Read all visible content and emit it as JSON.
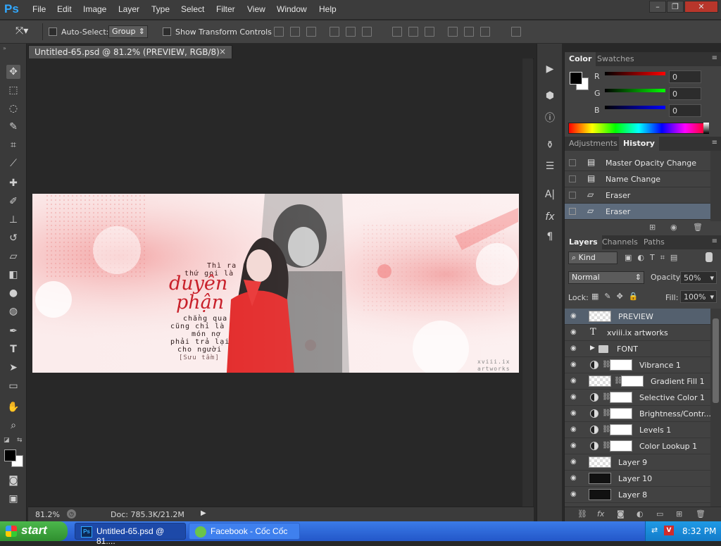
{
  "app": {
    "logo": "Ps",
    "menu": [
      "File",
      "Edit",
      "Image",
      "Layer",
      "Type",
      "Select",
      "Filter",
      "View",
      "Window",
      "Help"
    ],
    "window_controls": [
      "–",
      "❐",
      "✕"
    ]
  },
  "options_bar": {
    "auto_select_label": "Auto-Select:",
    "auto_select_value": "Group",
    "show_transform_label": "Show Transform Controls"
  },
  "document": {
    "tab_title": "Untitled-65.psd @ 81.2% (PREVIEW, RGB/8) *",
    "close": "×",
    "artwork_text": {
      "line1": "Thì ra",
      "line2": "thứ gọi là",
      "title1": "duyên",
      "title2": "phận",
      "line3": "chẳng qua",
      "line4": "cũng chỉ là",
      "line5": "món nợ",
      "line6": "phải trả lại",
      "line7": "cho người",
      "credit": "[Sưu tầm]",
      "watermark1": "xviii.ix",
      "watermark2": "artworks"
    }
  },
  "status_bar": {
    "zoom": "81.2%",
    "doc_info": "Doc: 785.3K/21.2M"
  },
  "color_panel": {
    "tabs": [
      "Color",
      "Swatches"
    ],
    "active_tab": "Color",
    "channels": [
      {
        "label": "R",
        "value": "0",
        "color": "#e01010"
      },
      {
        "label": "G",
        "value": "0",
        "color": "#10c010"
      },
      {
        "label": "B",
        "value": "0",
        "color": "#1010e0"
      }
    ]
  },
  "history_panel": {
    "tabs": [
      "Adjustments",
      "History"
    ],
    "active_tab": "History",
    "items": [
      "Master Opacity Change",
      "Name Change",
      "Eraser",
      "Eraser"
    ]
  },
  "layers_panel": {
    "tabs": [
      "Layers",
      "Channels",
      "Paths"
    ],
    "active_tab": "Layers",
    "kind_label": "Kind",
    "blend_mode": "Normal",
    "opacity_label": "Opacity:",
    "opacity_value": "50%",
    "lock_label": "Lock:",
    "fill_label": "Fill:",
    "fill_value": "100%",
    "layers": [
      {
        "name": "PREVIEW",
        "type": "pixel",
        "selected": true
      },
      {
        "name": "xviii.ix artworks",
        "type": "text"
      },
      {
        "name": "FONT",
        "type": "group"
      },
      {
        "name": "Vibrance 1",
        "type": "adjustment"
      },
      {
        "name": "Gradient Fill 1",
        "type": "fill"
      },
      {
        "name": "Selective Color 1",
        "type": "adjustment"
      },
      {
        "name": "Brightness/Contr...",
        "type": "adjustment"
      },
      {
        "name": "Levels 1",
        "type": "adjustment"
      },
      {
        "name": "Color Lookup 1",
        "type": "adjustment"
      },
      {
        "name": "Layer 9",
        "type": "pixel"
      },
      {
        "name": "Layer 10",
        "type": "dark"
      },
      {
        "name": "Layer 8",
        "type": "dark"
      }
    ]
  },
  "taskbar": {
    "start": "start",
    "tasks": [
      "Untitled-65.psd @ 81....",
      "Facebook - Cốc Cốc"
    ],
    "clock": "8:32 PM"
  }
}
